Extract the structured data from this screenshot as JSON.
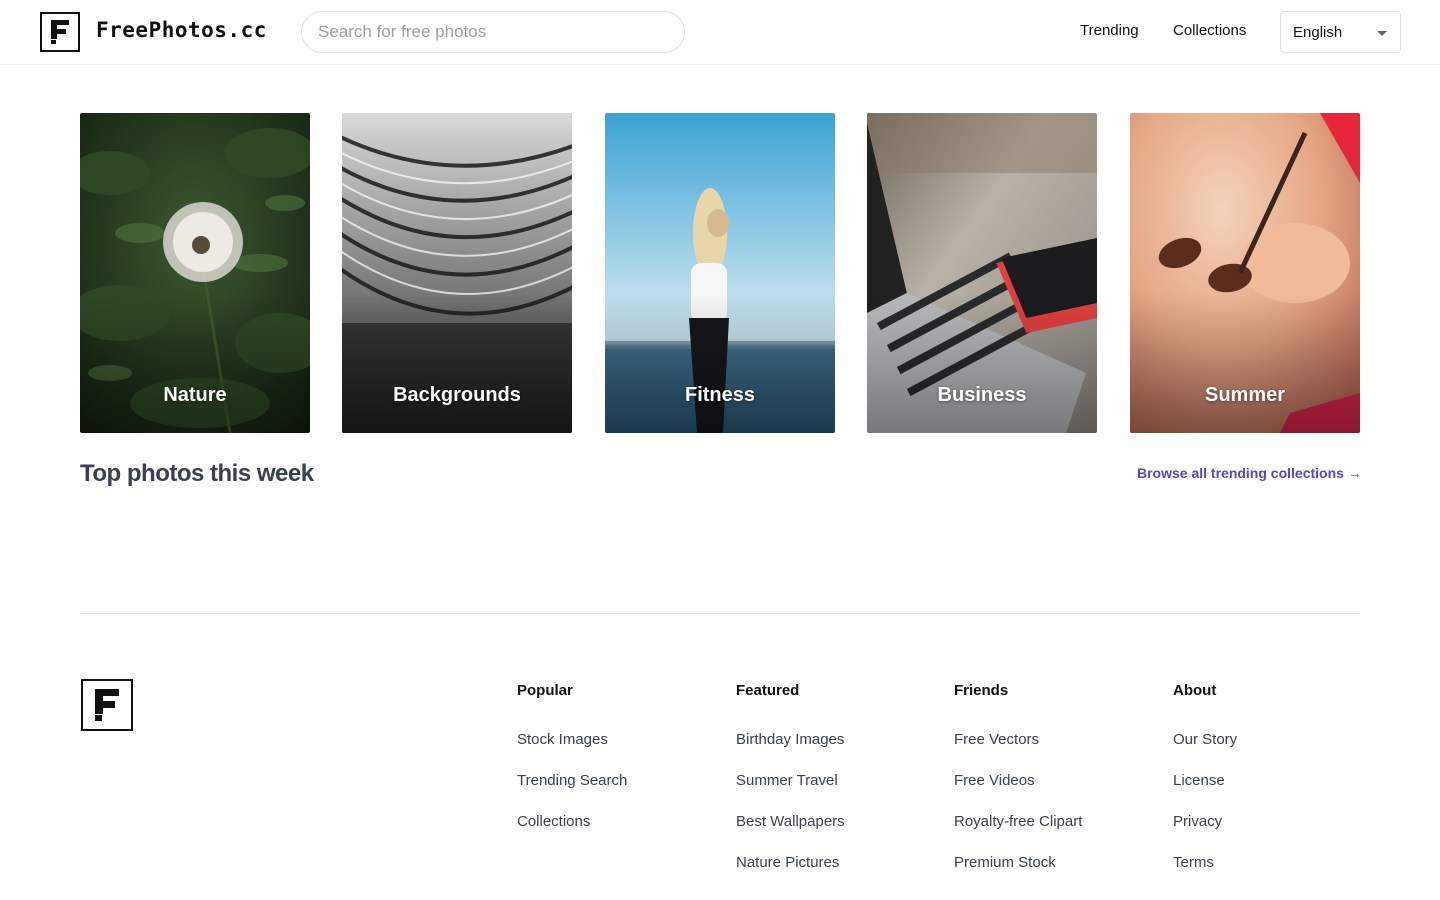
{
  "header": {
    "brand": "FreePhotos.cc",
    "search_placeholder": "Search for free photos",
    "nav": [
      "Trending",
      "Collections"
    ],
    "language": "English"
  },
  "categories": [
    {
      "label": "Nature"
    },
    {
      "label": "Backgrounds"
    },
    {
      "label": "Fitness"
    },
    {
      "label": "Business"
    },
    {
      "label": "Summer"
    }
  ],
  "section": {
    "title": "Top photos this week",
    "browse_link": "Browse all trending collections →"
  },
  "footer": {
    "columns": [
      {
        "heading": "Popular",
        "links": [
          "Stock Images",
          "Trending Search",
          "Collections"
        ]
      },
      {
        "heading": "Featured",
        "links": [
          "Birthday Images",
          "Summer Travel",
          "Best Wallpapers",
          "Nature Pictures"
        ]
      },
      {
        "heading": "Friends",
        "links": [
          "Free Vectors",
          "Free Videos",
          "Royalty-free Clipart",
          "Premium Stock"
        ]
      },
      {
        "heading": "About",
        "links": [
          "Our Story",
          "License",
          "Privacy",
          "Terms"
        ]
      }
    ]
  },
  "colors": {
    "accent_link": "#5046c8",
    "border": "#e2e2e2",
    "text_dark": "#111111"
  }
}
